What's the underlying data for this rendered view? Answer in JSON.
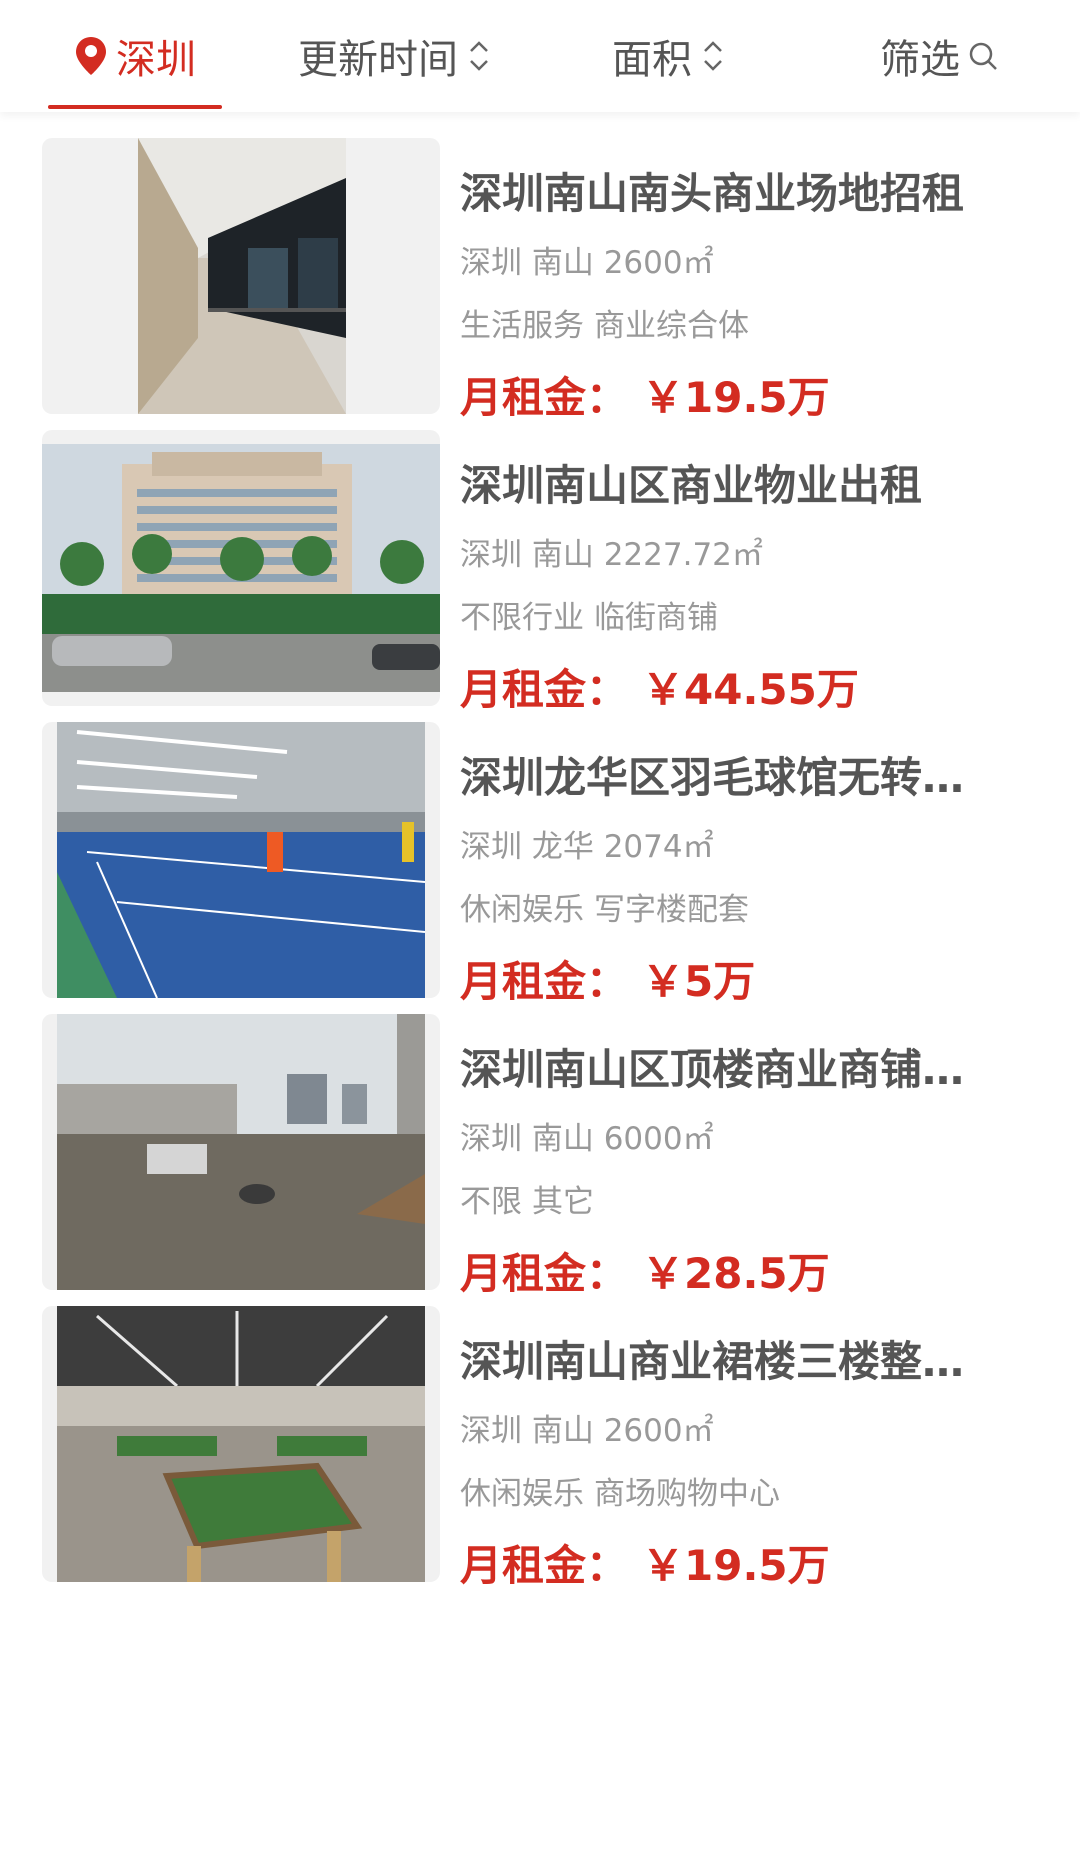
{
  "filters": {
    "city": "深圳",
    "updated": "更新时间",
    "area": "面积",
    "filter": "筛选"
  },
  "colors": {
    "accent": "#d32c21",
    "muted": "#999999"
  },
  "price_label": "月租金：",
  "listings": [
    {
      "title": "深圳南山南头商业场地招租",
      "location": "深圳 南山 2600㎡",
      "industry": "生活服务",
      "type": "商业综合体",
      "price": "￥19.5万",
      "image": "corridor-photo"
    },
    {
      "title": "深圳南山区商业物业出租",
      "location": "深圳 南山 2227.72㎡",
      "industry": "不限行业",
      "type": "临街商铺",
      "price": "￥44.55万",
      "image": "hotel-building-photo"
    },
    {
      "title": "深圳龙华区羽毛球馆无转让费",
      "location": "深圳 龙华 2074㎡",
      "industry": "休闲娱乐",
      "type": "写字楼配套",
      "price": "￥5万",
      "image": "badminton-court-photo"
    },
    {
      "title": "深圳南山区顶楼商业商铺出租",
      "location": "深圳 南山 6000㎡",
      "industry": "不限",
      "type": "其它",
      "price": "￥28.5万",
      "image": "rooftop-site-photo"
    },
    {
      "title": "深圳南山商业裙楼三楼整层出租",
      "location": "深圳 南山 2600㎡",
      "industry": "休闲娱乐",
      "type": "商场购物中心",
      "price": "￥19.5万",
      "image": "billiard-hall-photo"
    }
  ]
}
